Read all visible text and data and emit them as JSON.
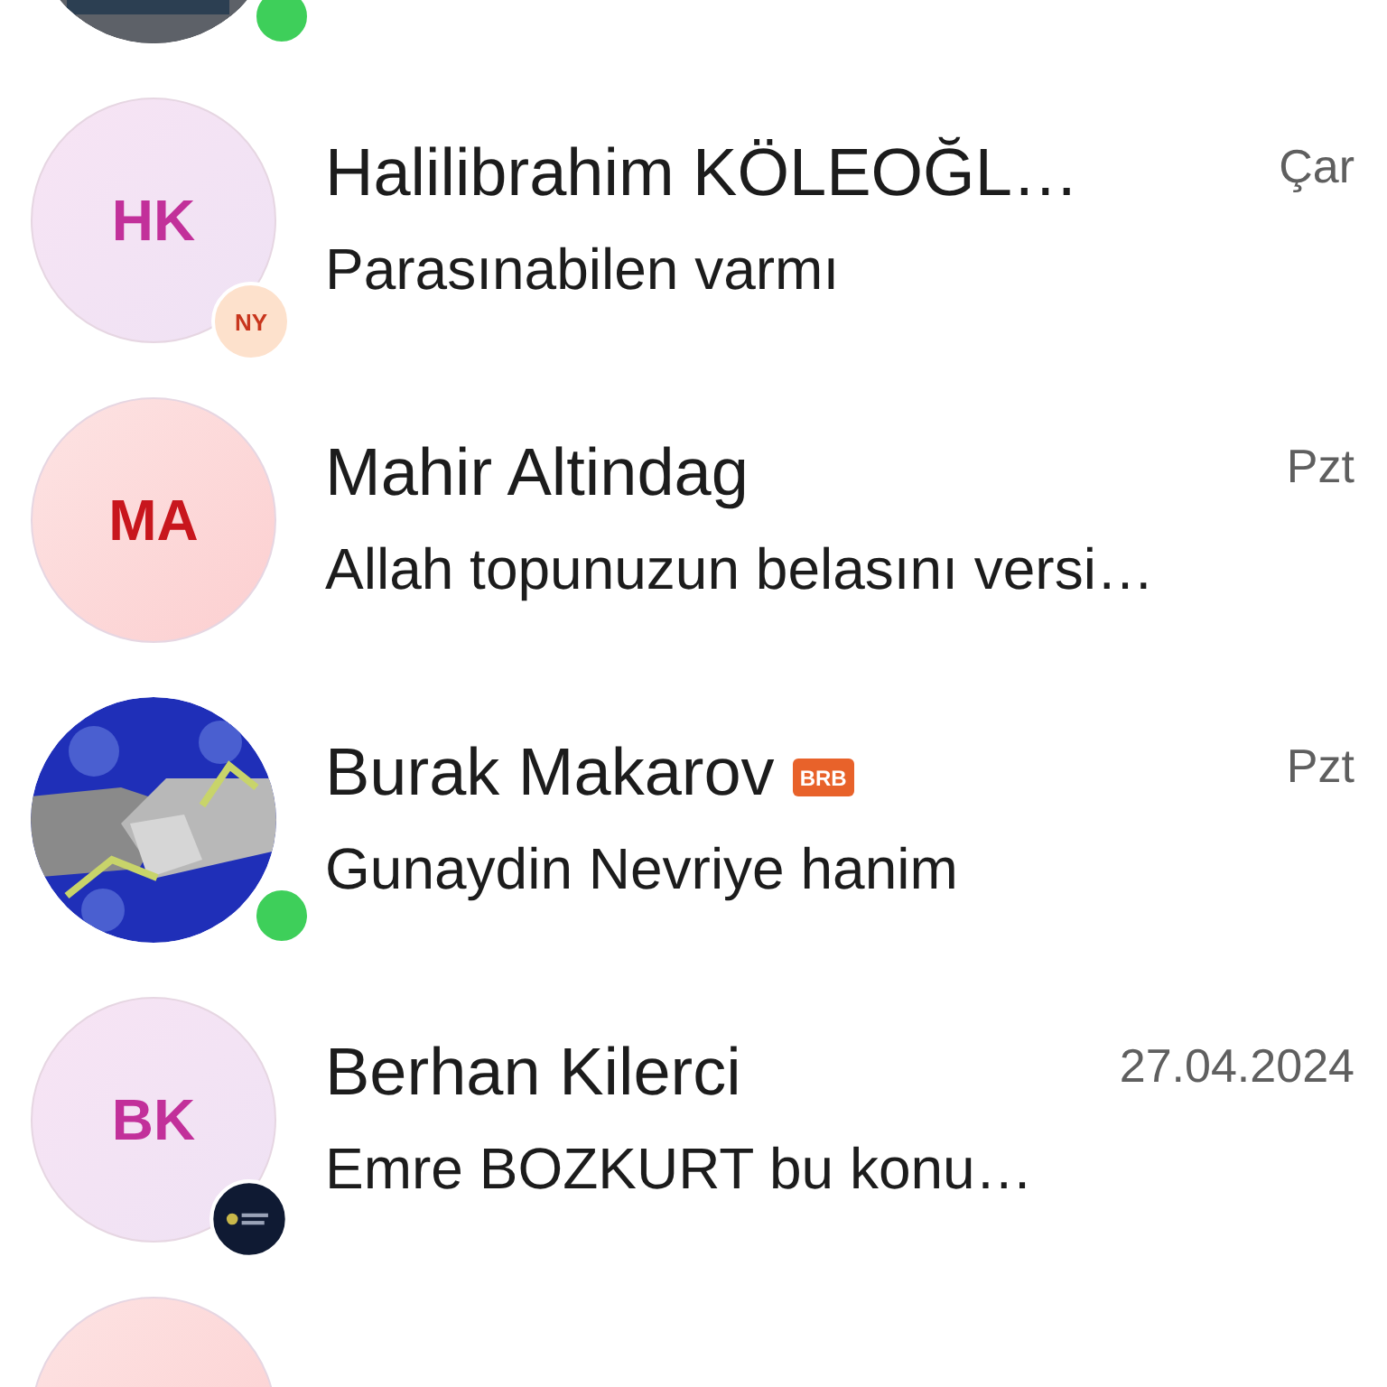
{
  "chats": [
    {
      "badge": {
        "kind": "online"
      }
    },
    {
      "avatar": {
        "kind": "initials",
        "text": "HK",
        "color": "#c2309a"
      },
      "badge": {
        "kind": "initials",
        "text": "NY"
      },
      "name": "Halilibrahim KÖLEOĞL…",
      "time": "Çar",
      "message": "Parasınabilen varmı"
    },
    {
      "avatar": {
        "kind": "initials",
        "text": "MA",
        "color": "#c8161d"
      },
      "name": "Mahir Altindag",
      "time": "Pzt",
      "message": "Allah topunuzun belasını versi…"
    },
    {
      "badge": {
        "kind": "online"
      },
      "name": "Burak Makarov",
      "tag": "BRB",
      "time": "Pzt",
      "message": "Gunaydin Nevriye hanim"
    },
    {
      "avatar": {
        "kind": "initials",
        "text": "BK",
        "color": "#c2309a"
      },
      "badge": {
        "kind": "logo"
      },
      "name": "Berhan Kilerci",
      "time": "27.04.2024",
      "message": "Emre BOZKURT bu konu…"
    },
    {
      "avatar": {
        "kind": "plain"
      }
    }
  ]
}
